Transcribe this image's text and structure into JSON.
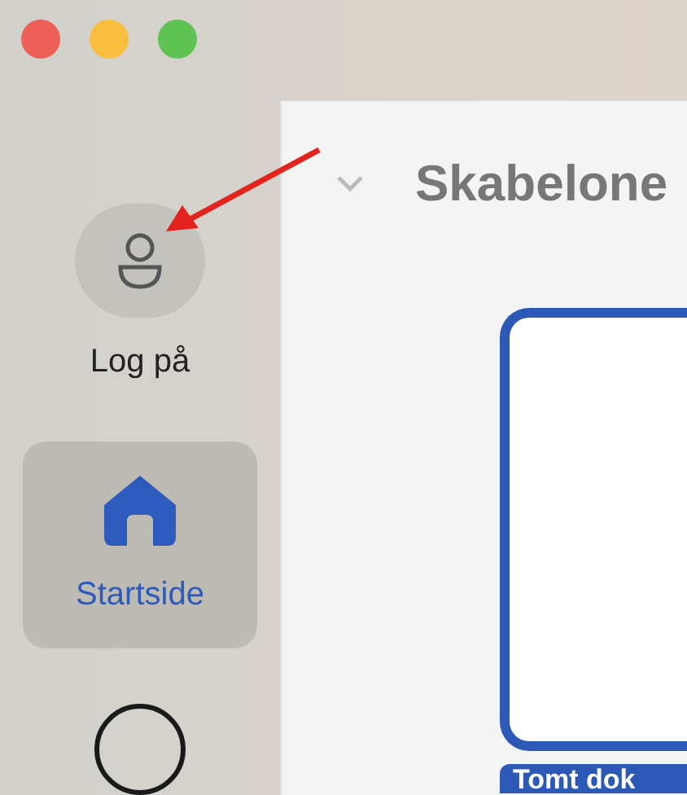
{
  "sidebar": {
    "account": {
      "label": "Log på"
    },
    "items": [
      {
        "label": "Startside",
        "selected": true
      }
    ]
  },
  "main": {
    "section": {
      "title": "Skabelone",
      "expanded": true
    },
    "templates": [
      {
        "label": "Tomt dok",
        "selected": true
      }
    ]
  }
}
